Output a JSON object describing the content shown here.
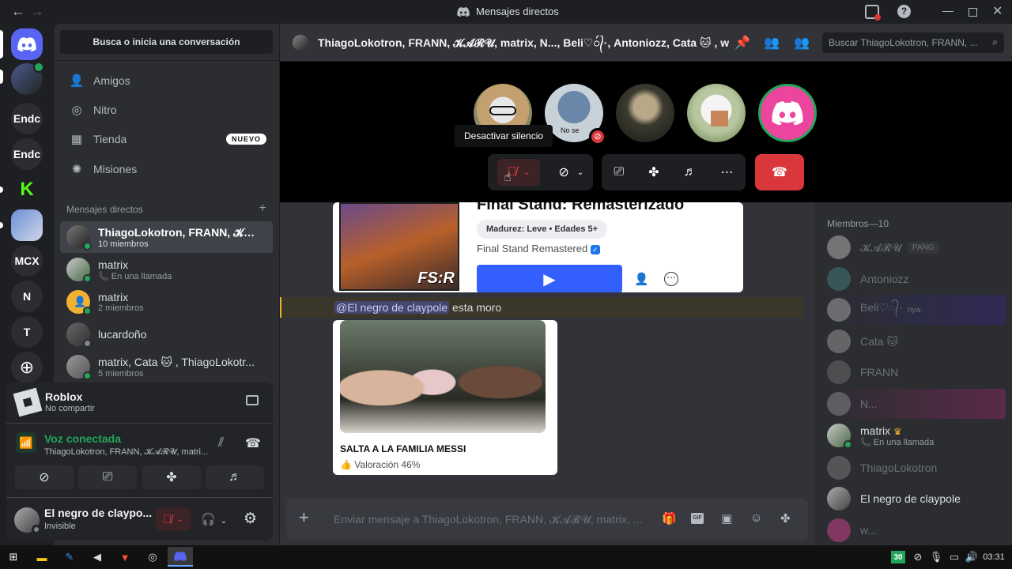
{
  "window": {
    "title": "Mensajes directos"
  },
  "rail": {
    "servers": [
      {
        "label": "Endc"
      },
      {
        "label": "Endc"
      },
      {
        "label": "MCX"
      },
      {
        "label": "N"
      },
      {
        "label": "T"
      }
    ]
  },
  "sidebar": {
    "search_label": "Busca o inicia una conversación",
    "nav": [
      {
        "label": "Amigos"
      },
      {
        "label": "Nitro"
      },
      {
        "label": "Tienda",
        "badge": "NUEVO"
      },
      {
        "label": "Misiones"
      }
    ],
    "dm_header": "Mensajes directos",
    "dms": [
      {
        "name": "ThiagoLokotron, FRANN, 𝓚𝓐𝓡𝓤, matrix...",
        "sub": "10 miembros"
      },
      {
        "name": "matrix",
        "sub": "En una llamada"
      },
      {
        "name": "matrix",
        "sub": "2 miembros"
      },
      {
        "name": "lucardoño",
        "sub": ""
      },
      {
        "name": "matrix, Cata 🐱 , ThiagoLokotr...",
        "sub": "5 miembros"
      }
    ]
  },
  "panel": {
    "activity_title": "Roblox",
    "activity_sub": "No compartir",
    "voice_title": "Voz conectada",
    "voice_sub": "ThiagoLokotron, FRANN, 𝓚𝓐𝓡𝓤, matri...",
    "user_name": "El negro de claypo...",
    "user_status": "Invisible"
  },
  "header": {
    "title": "ThiagoLokotron, FRANN, 𝓚𝓐𝓡𝓤, matrix, N..., Beli♡᭄·, Antoniozz, Cata 🐱 , w...",
    "search_placeholder": "Buscar ThiagoLokotron, FRANN, ..."
  },
  "call": {
    "avatar_label": "No se",
    "tooltip": "Desactivar silencio"
  },
  "messages": {
    "game_card": {
      "title": "Final Stand: Remasterizado",
      "rating": "Madurez: Leve • Edades 5+",
      "creator": "Final Stand Remastered",
      "logo": "FS:R"
    },
    "mention": "@El negro de claypole",
    "text": "esta moro",
    "experience_card": {
      "title": "SALTA A LA FAMILIA MESSI",
      "rating": "Valoración 46%"
    }
  },
  "composer": {
    "placeholder": "Enviar mensaje a ThiagoLokotron, FRANN, 𝓚𝓐𝓡𝓤, matrix, ..."
  },
  "members": {
    "header": "Miembros—10",
    "list": [
      {
        "name": "𝓚𝓐𝓡𝓤",
        "tag": "PANG",
        "online": false
      },
      {
        "name": "Antoniozz",
        "online": false
      },
      {
        "name": "Beli♡᭄·",
        "tag": "nya·",
        "online": false
      },
      {
        "name": "Cata 🐱",
        "online": false
      },
      {
        "name": "FRANN",
        "online": false
      },
      {
        "name": "N...",
        "online": false
      },
      {
        "name": "matrix",
        "sub": "En una llamada",
        "online": true
      },
      {
        "name": "ThiagoLokotron",
        "online": false
      },
      {
        "name": "El negro de claypole",
        "online": true
      },
      {
        "name": "w...",
        "online": false
      }
    ]
  },
  "taskbar": {
    "tray_badge": "30",
    "time": "03:31"
  },
  "colors": {
    "accent": "#5865f2",
    "green": "#23a55a",
    "danger": "#da373c"
  }
}
